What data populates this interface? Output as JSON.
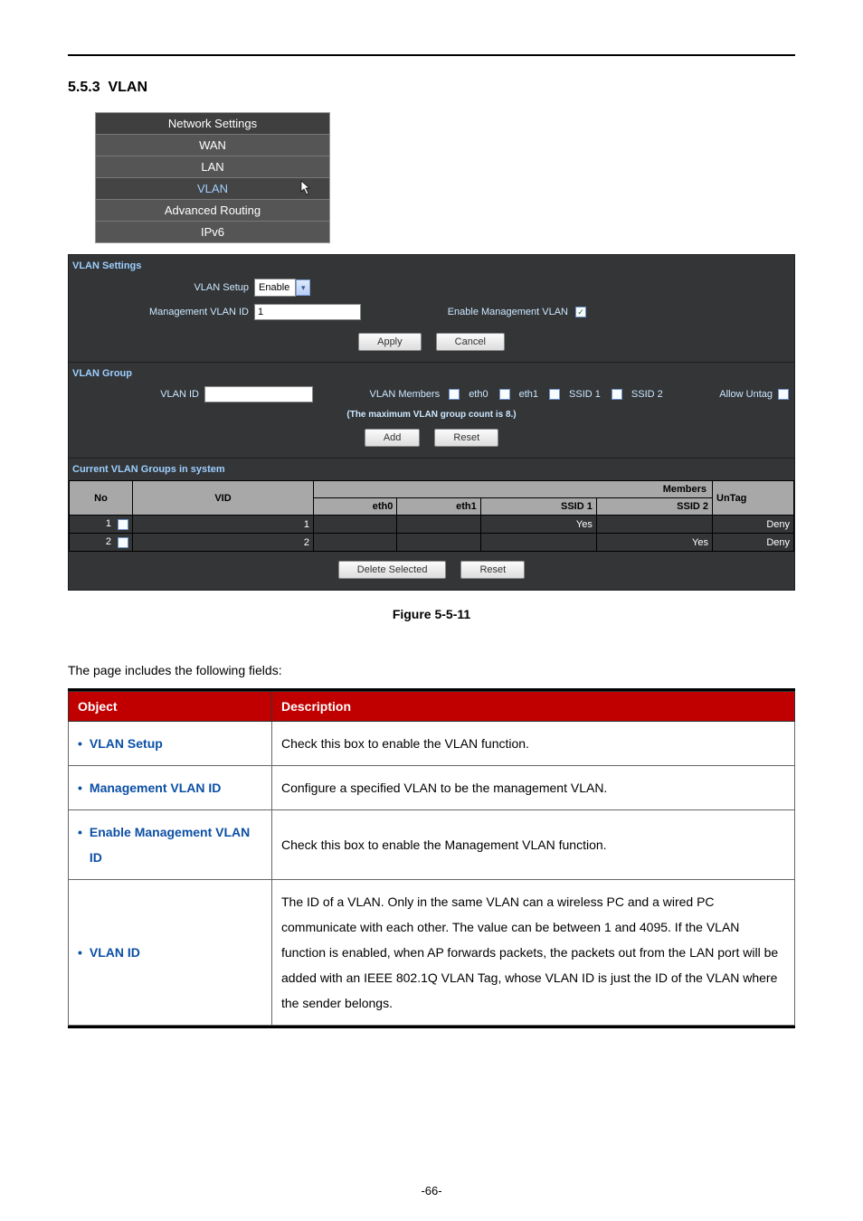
{
  "section": {
    "number": "5.5.3",
    "title": "VLAN"
  },
  "navmenu": {
    "header": "Network Settings",
    "items": [
      "WAN",
      "LAN",
      "VLAN",
      "Advanced Routing",
      "IPv6"
    ],
    "active_index": 2
  },
  "vlan_settings": {
    "title": "VLAN Settings",
    "setup_label": "VLAN Setup",
    "setup_value": "Enable",
    "mgmt_id_label": "Management VLAN ID",
    "mgmt_id_value": "1",
    "enable_mgmt_label": "Enable Management VLAN",
    "enable_mgmt_checked": true,
    "apply": "Apply",
    "cancel": "Cancel"
  },
  "vlan_group": {
    "title": "VLAN Group",
    "id_label": "VLAN ID",
    "id_value": "",
    "members_label": "VLAN Members",
    "members": [
      "eth0",
      "eth1",
      "SSID 1",
      "SSID 2"
    ],
    "allow_untag_label": "Allow Untag",
    "note": "(The maximum VLAN group count is 8.)",
    "add": "Add",
    "reset": "Reset"
  },
  "current_groups": {
    "title": "Current VLAN Groups in system",
    "headers": {
      "no": "No",
      "vid": "VID",
      "members": "Members",
      "eth0": "eth0",
      "eth1": "eth1",
      "ssid1": "SSID 1",
      "ssid2": "SSID 2",
      "untag": "UnTag"
    },
    "rows": [
      {
        "no": "1",
        "vid": "1",
        "eth0": "",
        "eth1": "",
        "ssid1": "Yes",
        "ssid2": "",
        "untag": "Deny"
      },
      {
        "no": "2",
        "vid": "2",
        "eth0": "",
        "eth1": "",
        "ssid1": "",
        "ssid2": "Yes",
        "untag": "Deny"
      }
    ],
    "delete": "Delete Selected",
    "reset": "Reset"
  },
  "figure_caption": "Figure 5-5-11",
  "intro_para": "The page includes the following fields:",
  "desc_table": {
    "object_header": "Object",
    "desc_header": "Description",
    "rows": [
      {
        "object": "VLAN Setup",
        "desc": "Check this box to enable the VLAN function."
      },
      {
        "object": "Management VLAN ID",
        "desc": "Configure a specified VLAN to be the management VLAN."
      },
      {
        "object": "Enable Management VLAN ID",
        "desc": "Check this box to enable the Management VLAN function."
      },
      {
        "object": "VLAN ID",
        "desc": "The ID of a VLAN. Only in the same VLAN can a wireless PC and a wired PC communicate with each other. The value can be between 1 and 4095. If the VLAN function is enabled, when AP forwards packets, the packets out from the LAN port will be added with an IEEE 802.1Q VLAN Tag, whose VLAN ID is just the ID of the VLAN where the sender belongs."
      }
    ]
  },
  "page_number": "-66-"
}
